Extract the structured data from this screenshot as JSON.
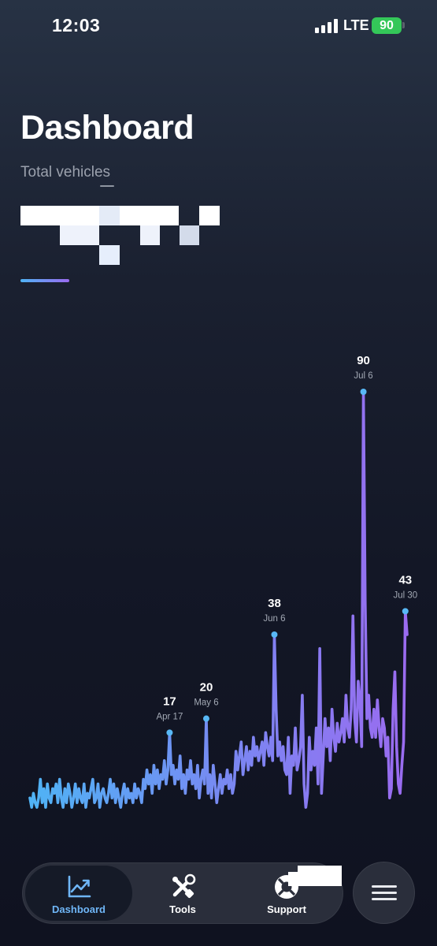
{
  "status_bar": {
    "time": "12:03",
    "network": "LTE",
    "battery": "90",
    "battery_color": "#34c759",
    "signal_icon": "cellular-signal-icon"
  },
  "header": {
    "title": "Dashboard",
    "subtitle": "Total vehicles"
  },
  "colors": {
    "accent_start": "#4fb3f5",
    "accent_end": "#9a6bf0",
    "active_tab_label": "#6fb6f7"
  },
  "chart_data": {
    "type": "line",
    "title": "",
    "xlabel": "",
    "ylabel": "",
    "ylim": [
      0,
      90
    ],
    "grid": false,
    "legend": "none",
    "series": [
      {
        "values": [
          3,
          1,
          4,
          2,
          1,
          3,
          7,
          2,
          5,
          1,
          6,
          3,
          2,
          5,
          4,
          6,
          2,
          7,
          3,
          1,
          5,
          2,
          6,
          4,
          1,
          3,
          6,
          2,
          5,
          3,
          2,
          6,
          1,
          4,
          3,
          5,
          7,
          2,
          3,
          6,
          1,
          4,
          5,
          3,
          2,
          4,
          7,
          3,
          6,
          2,
          5,
          3,
          1,
          4,
          6,
          2,
          5,
          3,
          4,
          2,
          6,
          3,
          5,
          4,
          2,
          7,
          5,
          9,
          6,
          8,
          4,
          10,
          6,
          9,
          5,
          8,
          7,
          11,
          6,
          9,
          17,
          8,
          10,
          6,
          9,
          7,
          12,
          5,
          8,
          4,
          9,
          7,
          11,
          6,
          8,
          5,
          10,
          3,
          7,
          9,
          6,
          20,
          4,
          8,
          3,
          10,
          6,
          2,
          5,
          8,
          4,
          7,
          6,
          9,
          5,
          8,
          4,
          6,
          13,
          9,
          12,
          15,
          8,
          11,
          14,
          9,
          13,
          10,
          16,
          12,
          14,
          11,
          13,
          15,
          10,
          17,
          14,
          12,
          16,
          11,
          38,
          22,
          12,
          15,
          11,
          14,
          9,
          8,
          16,
          4,
          12,
          10,
          18,
          9,
          11,
          14,
          25,
          6,
          1,
          4,
          16,
          9,
          13,
          10,
          18,
          6,
          35,
          4,
          12,
          20,
          14,
          18,
          11,
          22,
          16,
          13,
          19,
          15,
          17,
          20,
          15,
          25,
          18,
          16,
          22,
          42,
          20,
          15,
          28,
          24,
          14,
          90,
          45,
          20,
          25,
          18,
          16,
          22,
          16,
          24,
          18,
          14,
          20,
          18,
          12,
          16,
          3,
          5,
          22,
          30,
          14,
          6,
          4,
          10,
          15,
          43,
          38
        ]
      }
    ],
    "annotations": [
      {
        "index": 80,
        "value": "17",
        "date": "Apr 17"
      },
      {
        "index": 101,
        "value": "20",
        "date": "May 6"
      },
      {
        "index": 140,
        "value": "38",
        "date": "Jun 6"
      },
      {
        "index": 191,
        "value": "90",
        "date": "Jul 6"
      },
      {
        "index": 215,
        "value": "43",
        "date": "Jul 30"
      }
    ]
  },
  "tabs": [
    {
      "label": "Dashboard",
      "icon": "chart-icon",
      "active": true
    },
    {
      "label": "Tools",
      "icon": "tools-icon",
      "active": false
    },
    {
      "label": "Support",
      "icon": "lifebuoy-icon",
      "active": false
    }
  ],
  "menu_button": {
    "icon": "hamburger-menu-icon"
  }
}
